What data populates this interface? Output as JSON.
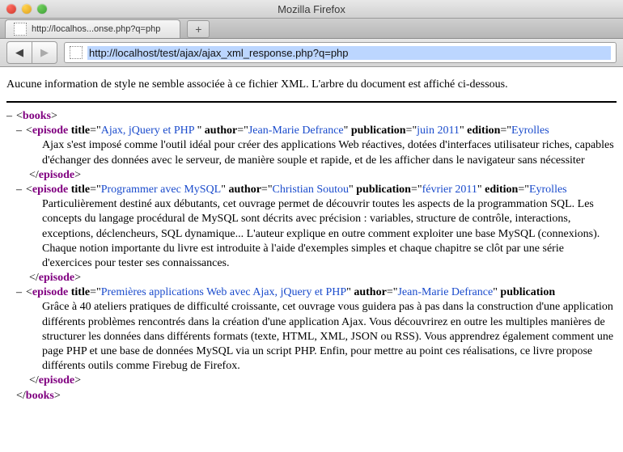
{
  "window": {
    "title": "Mozilla Firefox"
  },
  "tab": {
    "label": "http://localhos...onse.php?q=php"
  },
  "newtab_glyph": "+",
  "nav": {
    "back_glyph": "◀",
    "fwd_glyph": "▶"
  },
  "url": "http://localhost/test/ajax/ajax_xml_response.php?q=php",
  "notice": "Aucune information de style ne semble associée à ce fichier XML. L'arbre du document est affiché ci-dessous.",
  "xml": {
    "root_open": "books",
    "root_close": "books",
    "episode_tag": "episode",
    "attr_title": "title",
    "attr_author": "author",
    "attr_publication": "publication",
    "attr_edition": "edition",
    "episodes": [
      {
        "title": "Ajax, jQuery et PHP ",
        "author": "Jean-Marie Defrance",
        "publication": "juin 2011",
        "edition": "Eyrolles",
        "text": "Ajax s'est imposé comme l'outil idéal pour créer des applications Web réactives, dotées d'interfaces utilisateur riches, capables d'échanger des données avec le serveur, de manière souple et rapide, et de les afficher dans le navigateur sans nécessiter"
      },
      {
        "title": "Programmer avec MySQL",
        "author": "Christian Soutou",
        "publication": "février 2011",
        "edition": "Eyrolles",
        "text": "Particulièrement destiné aux débutants, cet ouvrage permet de découvrir toutes les aspects de la programmation SQL. Les concepts du langage procédural de MySQL sont décrits avec précision : variables, structure de contrôle, interactions, exceptions, déclencheurs, SQL dynamique... L'auteur explique en outre comment exploiter une base MySQL (connexions). Chaque notion importante du livre est introduite à l'aide d'exemples simples et chaque chapitre se clôt par une série d'exercices pour tester ses connaissances."
      },
      {
        "title": "Premières applications Web avec Ajax, jQuery et PHP",
        "author": "Jean-Marie Defrance",
        "publication_label_only": true,
        "text": "Grâce à 40 ateliers pratiques de difficulté croissante, cet ouvrage vous guidera pas à pas dans la construction d'une application différents problèmes rencontrés dans la création d'une application Ajax. Vous découvrirez en outre les multiples manières de structurer les données dans différents formats (texte, HTML, XML, JSON ou RSS). Vous apprendrez également comment une page PHP et une base de données MySQL via un script PHP. Enfin, pour mettre au point ces réalisations, ce livre propose différents outils comme Firebug de Firefox."
      }
    ]
  }
}
